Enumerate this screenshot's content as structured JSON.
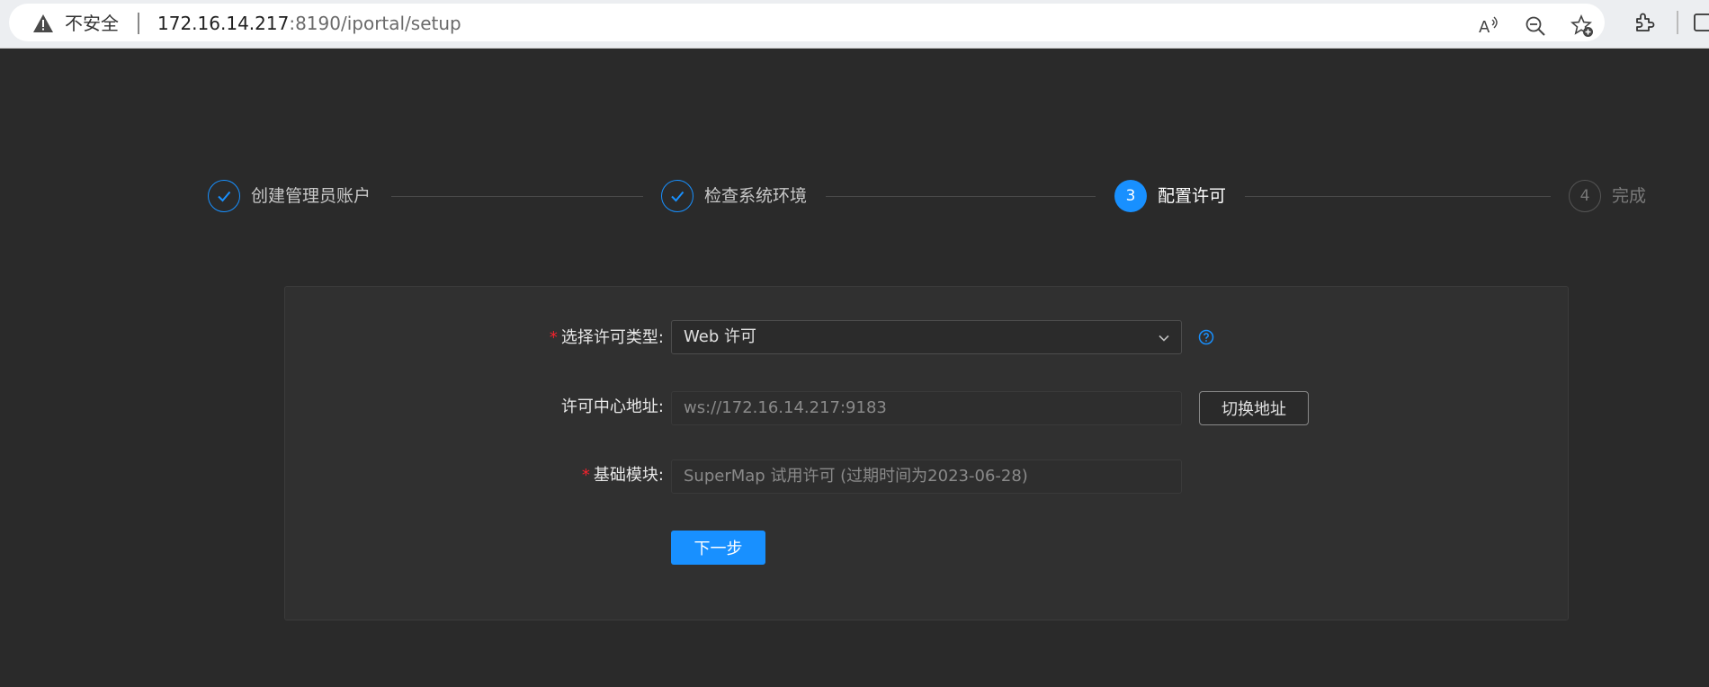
{
  "browser": {
    "security_label": "不安全",
    "url_host": "172.16.14.217",
    "url_rest": ":8190/iportal/setup",
    "icons": [
      "warning-icon",
      "read-aloud-icon",
      "zoom-out-icon",
      "favorite-add-icon",
      "extensions-icon",
      "split-screen-icon"
    ]
  },
  "steps": [
    {
      "label": "创建管理员账户",
      "status": "done",
      "marker": ""
    },
    {
      "label": "检查系统环境",
      "status": "done",
      "marker": ""
    },
    {
      "label": "配置许可",
      "status": "active",
      "marker": "3"
    },
    {
      "label": "完成",
      "status": "wait",
      "marker": "4"
    }
  ],
  "colors": {
    "accent": "#1890ff",
    "required": "#f5222d",
    "background": "#2a2a2a"
  },
  "form": {
    "license_type": {
      "label": "选择许可类型:",
      "value": "Web 许可",
      "required": true
    },
    "license_center": {
      "label": "许可中心地址:",
      "value": "ws://172.16.14.217:9183",
      "button": "切换地址"
    },
    "base_module": {
      "label": "基础模块:",
      "value": "SuperMap 试用许可  (过期时间为2023-06-28)",
      "required": true
    },
    "next_button": "下一步",
    "required_mark": "*"
  }
}
